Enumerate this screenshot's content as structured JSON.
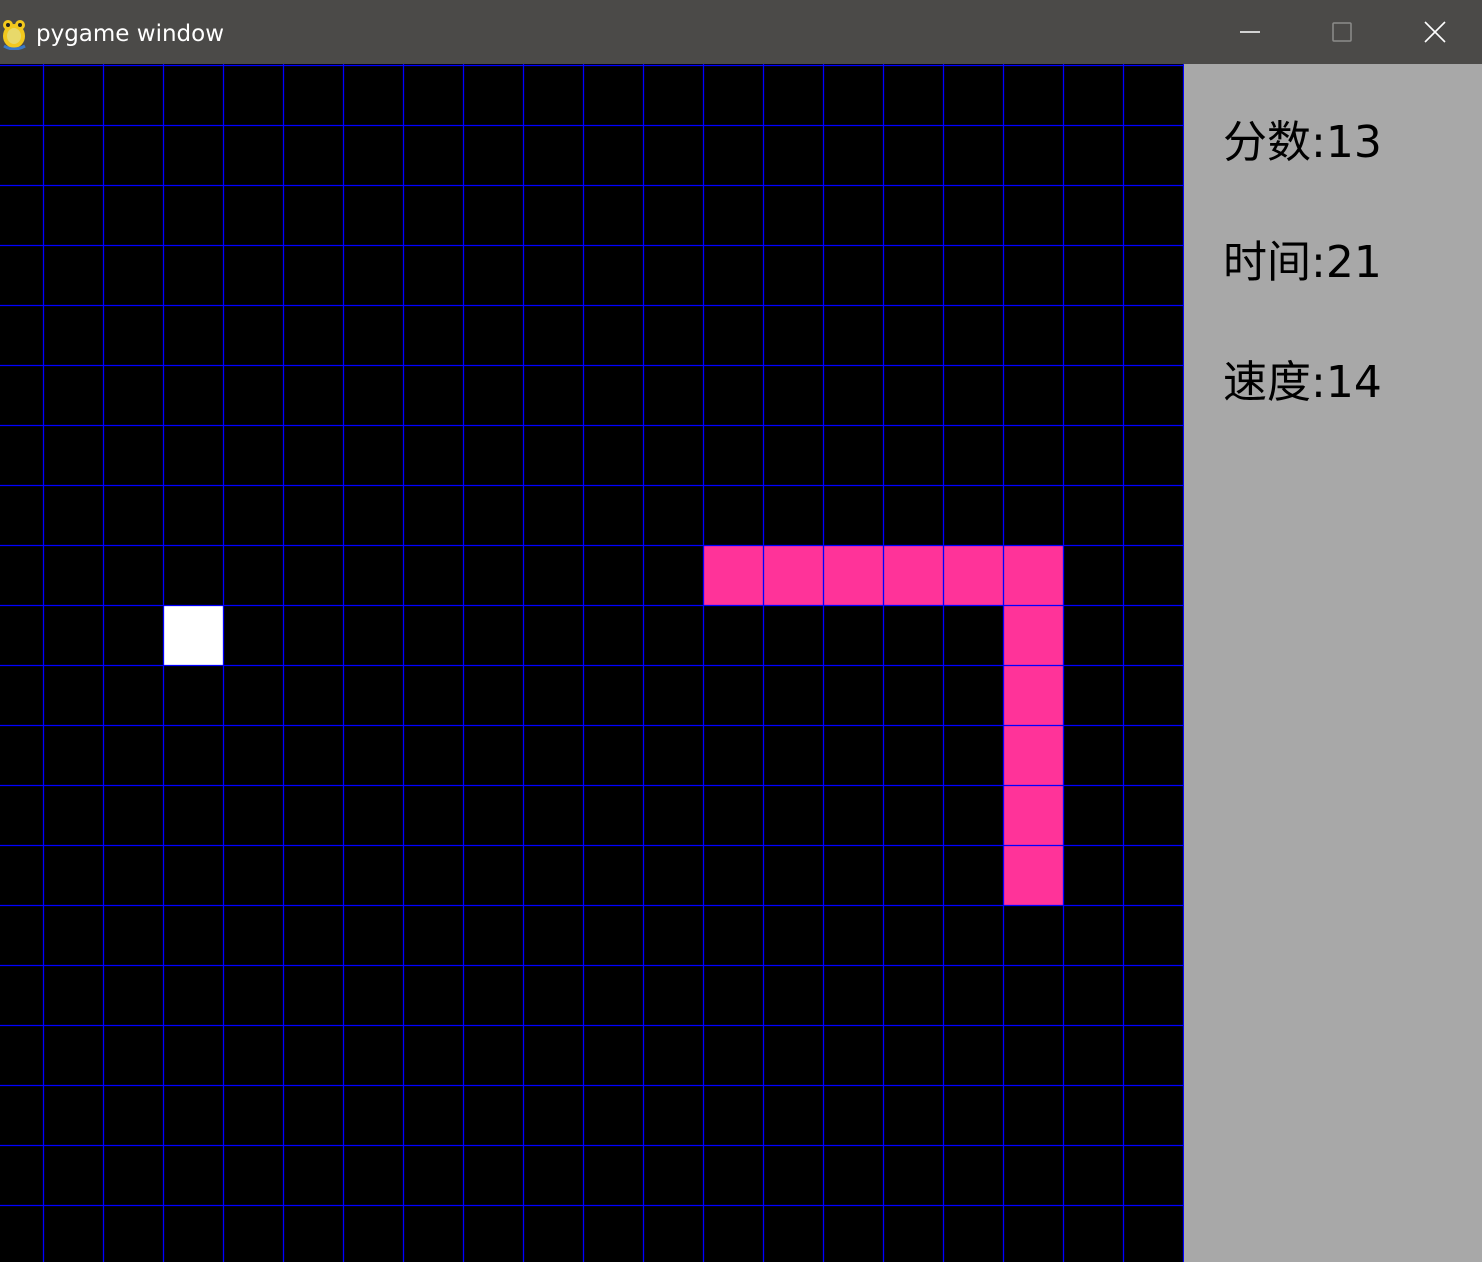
{
  "window": {
    "title": "pygame window",
    "icon": "pygame-snake-icon",
    "controls": [
      "minimize-icon",
      "maximize-icon",
      "close-icon"
    ]
  },
  "board": {
    "columns": 20,
    "visible_rows": 20,
    "background_color": "#000000",
    "grid_line_color": "#0000ff",
    "snake_color": "#ff3399",
    "food_color": "#ffffff",
    "food": {
      "col": 3,
      "row": 9
    },
    "snake": [
      {
        "col": 12,
        "row": 8
      },
      {
        "col": 13,
        "row": 8
      },
      {
        "col": 14,
        "row": 8
      },
      {
        "col": 15,
        "row": 8
      },
      {
        "col": 16,
        "row": 8
      },
      {
        "col": 17,
        "row": 8
      },
      {
        "col": 17,
        "row": 9
      },
      {
        "col": 17,
        "row": 10
      },
      {
        "col": 17,
        "row": 11
      },
      {
        "col": 17,
        "row": 12
      },
      {
        "col": 17,
        "row": 13
      }
    ]
  },
  "panel": {
    "background_color": "#a8a8a8",
    "score": {
      "label": "分数",
      "value": "13",
      "text": "分数:13"
    },
    "time": {
      "label": "时间",
      "value": "21",
      "text": "时间:21"
    },
    "speed": {
      "label": "速度",
      "value": "14",
      "text": "速度:14"
    }
  }
}
